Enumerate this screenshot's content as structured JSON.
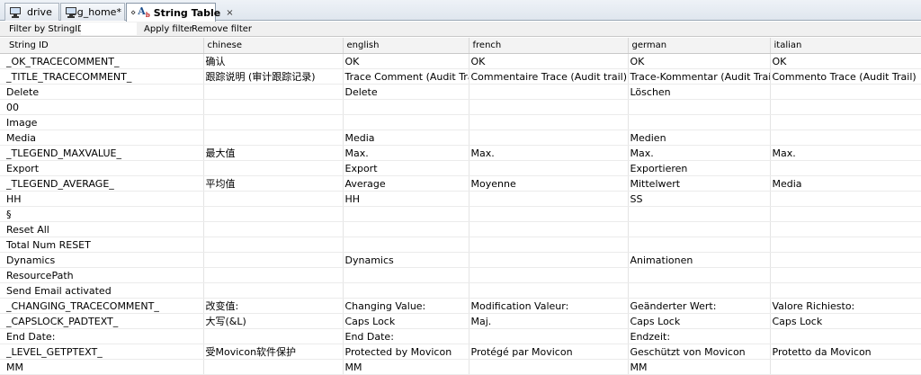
{
  "tabs": [
    {
      "label": "drive",
      "icon": "monitor-icon"
    },
    {
      "label": "jog_home*",
      "icon": "monitor-icon"
    },
    {
      "label": "String Table",
      "icon": "string-table-icon",
      "active": true,
      "close": "×"
    }
  ],
  "filter": {
    "label": "Filter by StringID:",
    "value": "",
    "apply_label": "Apply filter",
    "remove_label": "Remove filter"
  },
  "columns": [
    "String ID",
    "chinese",
    "english",
    "french",
    "german",
    "italian"
  ],
  "rows": [
    [
      "_OK_TRACECOMMENT_",
      "确认",
      "OK",
      "OK",
      "OK",
      "OK"
    ],
    [
      "_TITLE_TRACECOMMENT_",
      "跟踪说明 (审计跟踪记录)",
      "Trace Comment (Audit Trail)",
      "Commentaire Trace (Audit trail)",
      "Trace-Kommentar (Audit Trail)",
      "Commento Trace (Audit Trail)"
    ],
    [
      "Delete",
      "",
      "Delete",
      "",
      "Löschen",
      ""
    ],
    [
      "00",
      "",
      "",
      "",
      "",
      ""
    ],
    [
      "Image",
      "",
      "",
      "",
      "",
      ""
    ],
    [
      "Media",
      "",
      "Media",
      "",
      "Medien",
      ""
    ],
    [
      "_TLEGEND_MAXVALUE_",
      "最大值",
      "Max.",
      "Max.",
      "Max.",
      "Max."
    ],
    [
      "Export",
      "",
      "Export",
      "",
      "Exportieren",
      ""
    ],
    [
      "_TLEGEND_AVERAGE_",
      "平均值",
      "Average",
      "Moyenne",
      "Mittelwert",
      "Media"
    ],
    [
      "HH",
      "",
      "HH",
      "",
      "SS",
      ""
    ],
    [
      "§",
      "",
      "",
      "",
      "",
      ""
    ],
    [
      "Reset All",
      "",
      "",
      "",
      "",
      ""
    ],
    [
      "Total Num RESET",
      "",
      "",
      "",
      "",
      ""
    ],
    [
      "Dynamics",
      "",
      "Dynamics",
      "",
      "Animationen",
      ""
    ],
    [
      "ResourcePath",
      "",
      "",
      "",
      "",
      ""
    ],
    [
      "Send Email activated",
      "",
      "",
      "",
      "",
      ""
    ],
    [
      "_CHANGING_TRACECOMMENT_",
      "改变值:",
      "Changing Value:",
      "Modification Valeur:",
      "Geänderter Wert:",
      "Valore Richiesto:"
    ],
    [
      "_CAPSLOCK_PADTEXT_",
      "大写(&L)",
      "Caps Lock",
      "Maj.",
      "Caps Lock",
      "Caps Lock"
    ],
    [
      "End Date:",
      "",
      "End Date:",
      "",
      "Endzeit:",
      ""
    ],
    [
      "_LEVEL_GETPTEXT_",
      "受Movicon软件保护",
      "Protected by Movicon",
      "Protégé par Movicon",
      "Geschützt von Movicon",
      "Protetto da Movicon"
    ],
    [
      "MM",
      "",
      "MM",
      "",
      "MM",
      ""
    ]
  ]
}
